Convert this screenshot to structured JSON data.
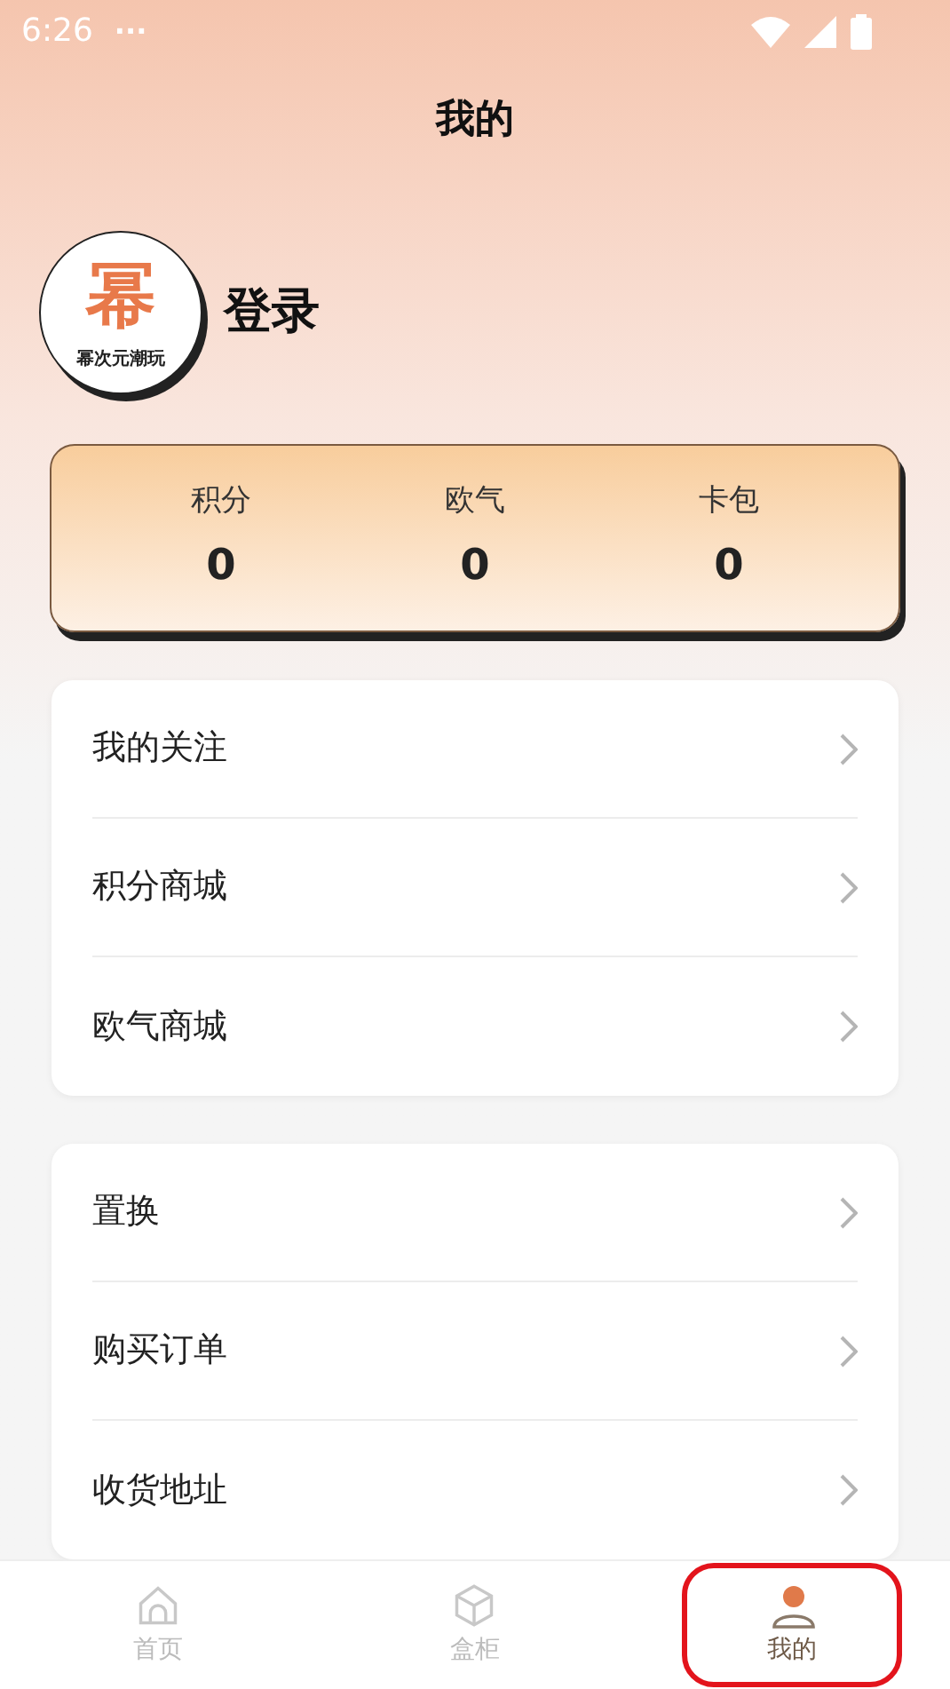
{
  "status_bar": {
    "time": "6:26",
    "more": "···"
  },
  "header": {
    "title": "我的"
  },
  "profile": {
    "logo_mark": "幂",
    "logo_caption": "幂次元潮玩",
    "name": "登录"
  },
  "stats": [
    {
      "label": "积分",
      "value": "0"
    },
    {
      "label": "欧气",
      "value": "0"
    },
    {
      "label": "卡包",
      "value": "0"
    }
  ],
  "menu_groups": [
    {
      "items": [
        {
          "label": "我的关注"
        },
        {
          "label": "积分商城"
        },
        {
          "label": "欧气商城"
        }
      ]
    },
    {
      "items": [
        {
          "label": "置换"
        },
        {
          "label": "购买订单"
        },
        {
          "label": "收货地址"
        }
      ]
    }
  ],
  "tab_bar": [
    {
      "kind": "home",
      "label": "首页",
      "selected": false,
      "highlighted": false
    },
    {
      "kind": "cabinet",
      "label": "盒柜",
      "selected": false,
      "highlighted": false
    },
    {
      "kind": "profile",
      "label": "我的",
      "selected": true,
      "highlighted": true
    }
  ]
}
